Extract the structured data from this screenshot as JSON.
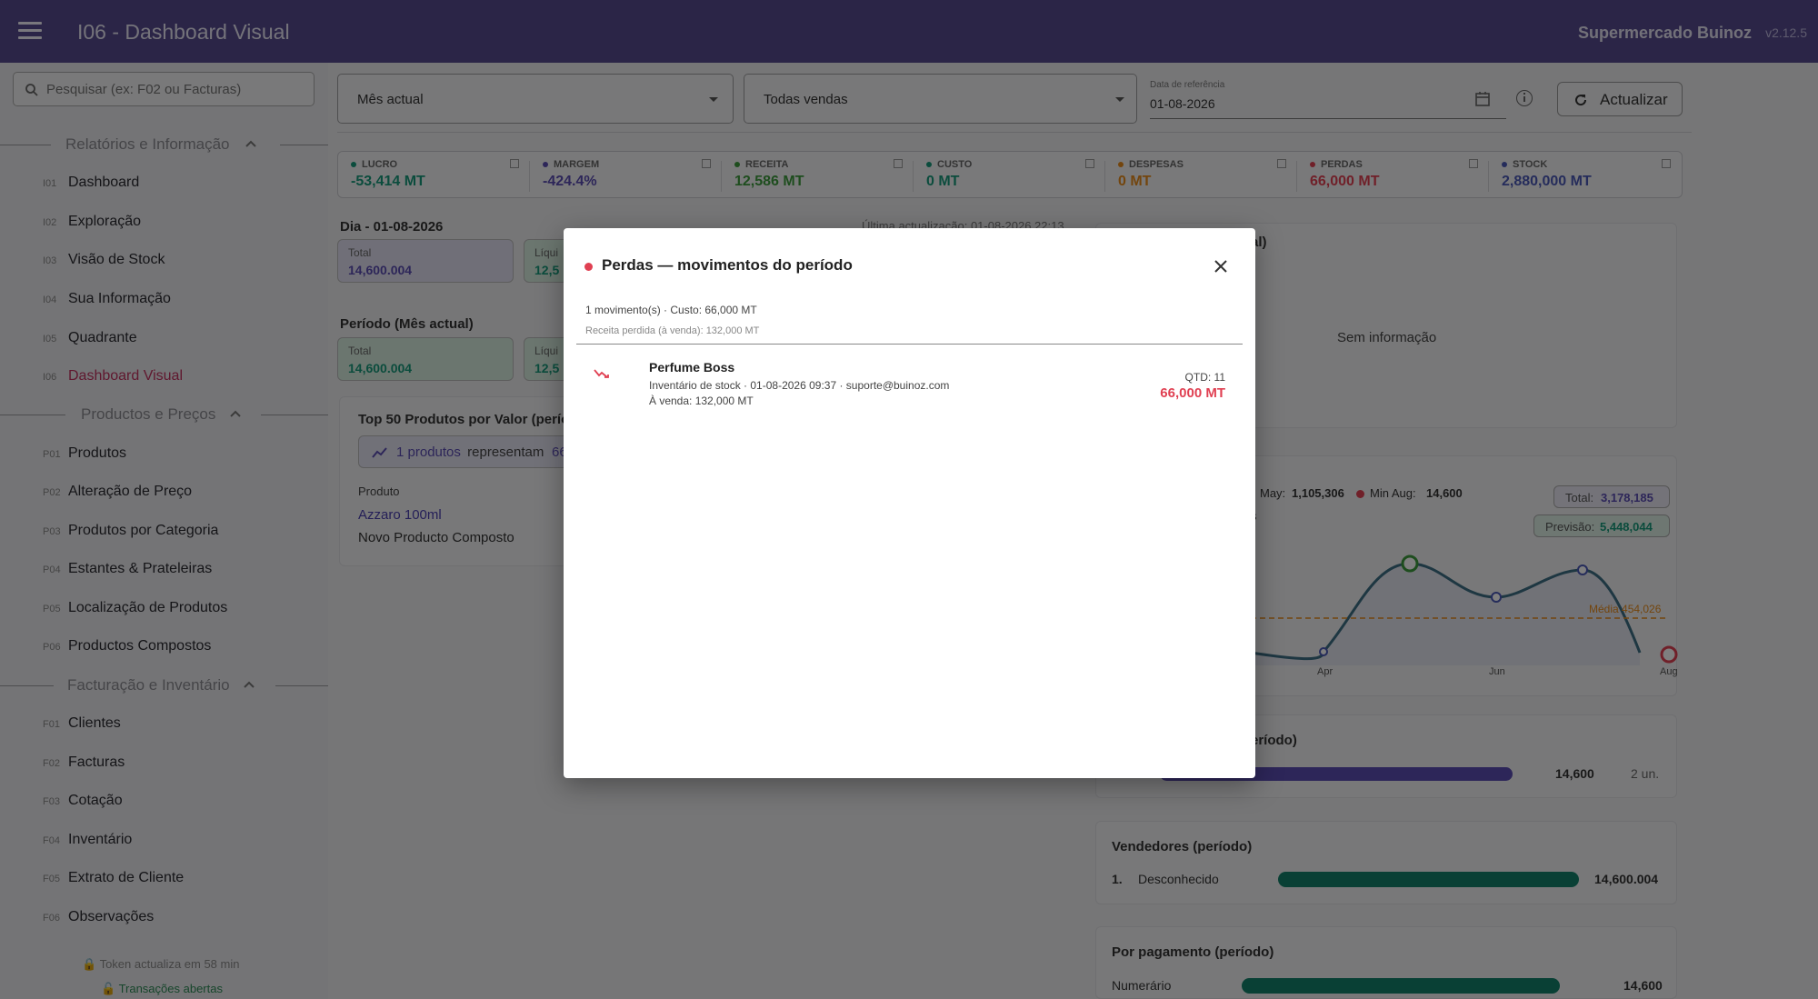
{
  "app": {
    "title": "I06 - Dashboard Visual",
    "org": "Supermercado Buinoz",
    "version": "v2.12.5"
  },
  "search": {
    "placeholder": "Pesquisar (ex: F02 ou Facturas)"
  },
  "sections": [
    {
      "label": "Relatórios e Informação",
      "items": [
        {
          "code": "I01",
          "label": "Dashboard"
        },
        {
          "code": "I02",
          "label": "Exploração"
        },
        {
          "code": "I03",
          "label": "Visão de Stock"
        },
        {
          "code": "I04",
          "label": "Sua Informação"
        },
        {
          "code": "I05",
          "label": "Quadrante"
        },
        {
          "code": "I06",
          "label": "Dashboard Visual",
          "active": true
        }
      ]
    },
    {
      "label": "Productos e Preços",
      "items": [
        {
          "code": "P01",
          "label": "Produtos"
        },
        {
          "code": "P02",
          "label": "Alteração de Preço"
        },
        {
          "code": "P03",
          "label": "Produtos por Categoria"
        },
        {
          "code": "P04",
          "label": "Estantes & Prateleiras"
        },
        {
          "code": "P05",
          "label": "Localização de Produtos"
        },
        {
          "code": "P06",
          "label": "Productos Compostos"
        }
      ]
    },
    {
      "label": "Facturação e Inventário",
      "items": [
        {
          "code": "F01",
          "label": "Clientes"
        },
        {
          "code": "F02",
          "label": "Facturas"
        },
        {
          "code": "F03",
          "label": "Cotação"
        },
        {
          "code": "F04",
          "label": "Inventário"
        },
        {
          "code": "F05",
          "label": "Extrato de Cliente"
        },
        {
          "code": "F06",
          "label": "Observações"
        }
      ]
    }
  ],
  "footer": {
    "token": "🔒 Token actualiza em 58 min",
    "transactions": "🔓 Transações abertas"
  },
  "filters": {
    "period": "Mês actual",
    "sales": "Todas vendas",
    "date_label": "Data de referência",
    "date": "01-08-2026",
    "refresh": "Actualizar"
  },
  "kpis": [
    {
      "name": "LUCRO",
      "value": "-53,414 MT",
      "color": "#17997a"
    },
    {
      "name": "MARGEM",
      "value": "-424.4%",
      "color": "#5a4cb2"
    },
    {
      "name": "RECEITA",
      "value": "12,586 MT",
      "color": "#3d9a3d"
    },
    {
      "name": "CUSTO",
      "value": "0 MT",
      "color": "#17997a"
    },
    {
      "name": "DESPESAS",
      "value": "0 MT",
      "color": "#e68a1a"
    },
    {
      "name": "PERDAS",
      "value": "66,000 MT",
      "color": "#e04052"
    },
    {
      "name": "STOCK",
      "value": "2,880,000 MT",
      "color": "#4a58b6"
    }
  ],
  "day": {
    "title": "Dia - 01-08-2026",
    "total_label": "Total",
    "total_value": "14,600.004",
    "liquid_label": "Líqui",
    "liquid_value": "12,5",
    "last_update": "Última actualização: 01-08-2026 22:13"
  },
  "period": {
    "title": "Período (Mês actual)",
    "total_label": "Total",
    "total_value": "14,600.004",
    "liquid_label": "Líqui",
    "liquid_value": "12,5"
  },
  "top50": {
    "title": "Top 50 Produtos por Valor (períod",
    "badge_a": "1 produtos",
    "badge_b": " representam ",
    "badge_c": "66%",
    "col_product": "Produto",
    "rows": [
      "Azzaro 100ml",
      "Novo Producto Composto"
    ]
  },
  "right_top": {
    "title_fragment": "al)",
    "empty": "Sem informação"
  },
  "trend": {
    "max_label": "May: ",
    "max_value": "1,105,306",
    "min_label": "Min Aug: ",
    "min_value": "14,600",
    "fragment": "s",
    "total_label": "Total: ",
    "total_value": "3,178,185",
    "forecast_label": "Previsão: ",
    "forecast_value": "5,448,044",
    "avg_label": "Média 454,026",
    "x_ticks": [
      "Apr",
      "Jun",
      "Aug"
    ]
  },
  "category": {
    "title_fragment": "eríodo)",
    "value": "14,600",
    "units": "2 un.",
    "fill": 1.0
  },
  "sellers": {
    "title": "Vendedores (período)",
    "rank": "1.",
    "name": "Desconhecido",
    "value": "14,600.004",
    "fill": 1.0
  },
  "payment": {
    "title": "Por pagamento (período)",
    "name": "Numerário",
    "value": "14,600",
    "fill": 1.0
  },
  "modal": {
    "title": "Perdas — movimentos do período",
    "summary": "1 movimento(s) · Custo: 66,000 MT",
    "lost_revenue": "Receita perdida (à venda): 132,000 MT",
    "item_name": "Perfume Boss",
    "item_detail": "Inventário de stock · 01-08-2026 09:37 · suporte@buinoz.com",
    "item_sale": "À venda: 132,000 MT",
    "item_qty": "QTD: 11",
    "item_cost": "66,000 MT"
  }
}
